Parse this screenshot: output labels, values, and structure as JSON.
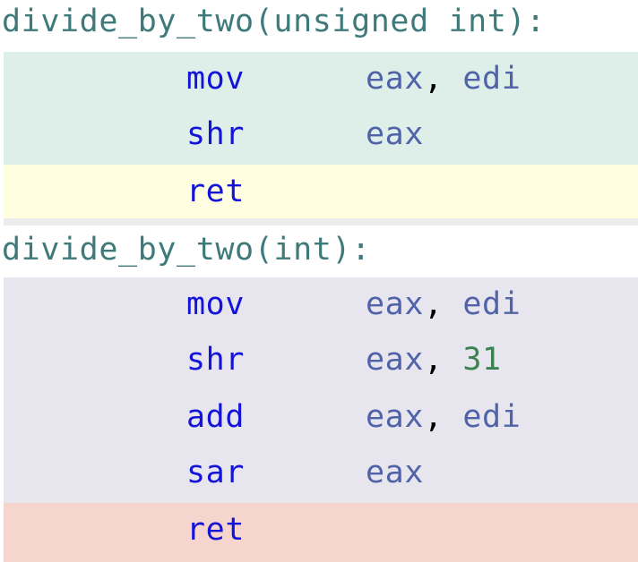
{
  "functions": [
    {
      "label": "divide_by_two(unsigned int):",
      "instructions": [
        {
          "mnemonic": "mov",
          "op1": "eax",
          "sep": ",",
          "op2": "edi",
          "op2_type": "reg"
        },
        {
          "mnemonic": "shr",
          "op1": "eax",
          "sep": "",
          "op2": "",
          "op2_type": "reg"
        },
        {
          "mnemonic": "ret",
          "op1": "",
          "sep": "",
          "op2": "",
          "op2_type": "reg"
        }
      ]
    },
    {
      "label": "divide_by_two(int):",
      "instructions": [
        {
          "mnemonic": "mov",
          "op1": "eax",
          "sep": ",",
          "op2": "edi",
          "op2_type": "reg"
        },
        {
          "mnemonic": "shr",
          "op1": "eax",
          "sep": ",",
          "op2": "31",
          "op2_type": "num"
        },
        {
          "mnemonic": "add",
          "op1": "eax",
          "sep": ",",
          "op2": "edi",
          "op2_type": "reg"
        },
        {
          "mnemonic": "sar",
          "op1": "eax",
          "sep": "",
          "op2": "",
          "op2_type": "reg"
        },
        {
          "mnemonic": "ret",
          "op1": "",
          "sep": "",
          "op2": "",
          "op2_type": "reg"
        }
      ]
    }
  ],
  "colors": {
    "label": "#3f7a7a",
    "mnemonic": "#1414d8",
    "register": "#5063a8",
    "number": "#3b8250",
    "band_unsigned_body": "#deeee8",
    "band_unsigned_ret": "#fffee0",
    "band_signed_body": "#e7e5ee",
    "band_signed_ret": "#f5d5ce"
  }
}
